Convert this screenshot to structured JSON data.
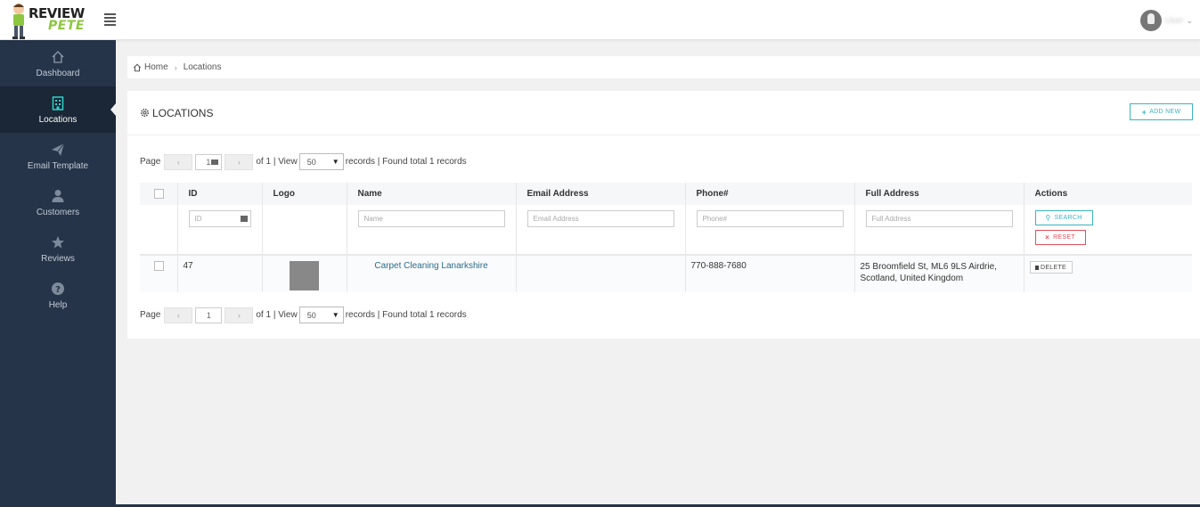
{
  "brand": {
    "line1": "REVIEW",
    "line2": "PETE"
  },
  "user": {
    "name": "User"
  },
  "sidebar": {
    "items": [
      {
        "label": "Dashboard",
        "icon": "home-icon"
      },
      {
        "label": "Locations",
        "icon": "building-icon"
      },
      {
        "label": "Email Template",
        "icon": "paper-plane-icon"
      },
      {
        "label": "Customers",
        "icon": "user-icon"
      },
      {
        "label": "Reviews",
        "icon": "star-icon"
      },
      {
        "label": "Help",
        "icon": "question-icon"
      }
    ],
    "active": "Locations"
  },
  "breadcrumb": {
    "home": "Home",
    "current": "Locations"
  },
  "panel": {
    "title": "LOCATIONS",
    "add_label": "ADD NEW"
  },
  "pager": {
    "page_label": "Page",
    "prev": "‹",
    "next": "›",
    "page_value": "1",
    "of_text": "of 1 | View",
    "per_page": "50",
    "records_text": "records | Found total 1 records"
  },
  "table": {
    "headers": [
      "ID",
      "Logo",
      "Name",
      "Email Address",
      "Phone#",
      "Full Address",
      "Actions"
    ],
    "filters": {
      "id": "ID",
      "name": "Name",
      "email": "Email Address",
      "phone": "Phone#",
      "address": "Full Address"
    },
    "search_label": "SEARCH",
    "reset_label": "RESET",
    "rows": [
      {
        "id": "47",
        "name": "Carpet Cleaning Lanarkshire",
        "email": "",
        "phone": "770-888-7680",
        "address": "25 Broomfield St, ML6 9LS Airdrie, Scotland, United Kingdom",
        "delete_label": "DELETE"
      }
    ]
  },
  "colors": {
    "sidebar": "#253449",
    "accent": "#3bb3c3",
    "danger": "#e2505a",
    "brand_green": "#8dc63f"
  }
}
